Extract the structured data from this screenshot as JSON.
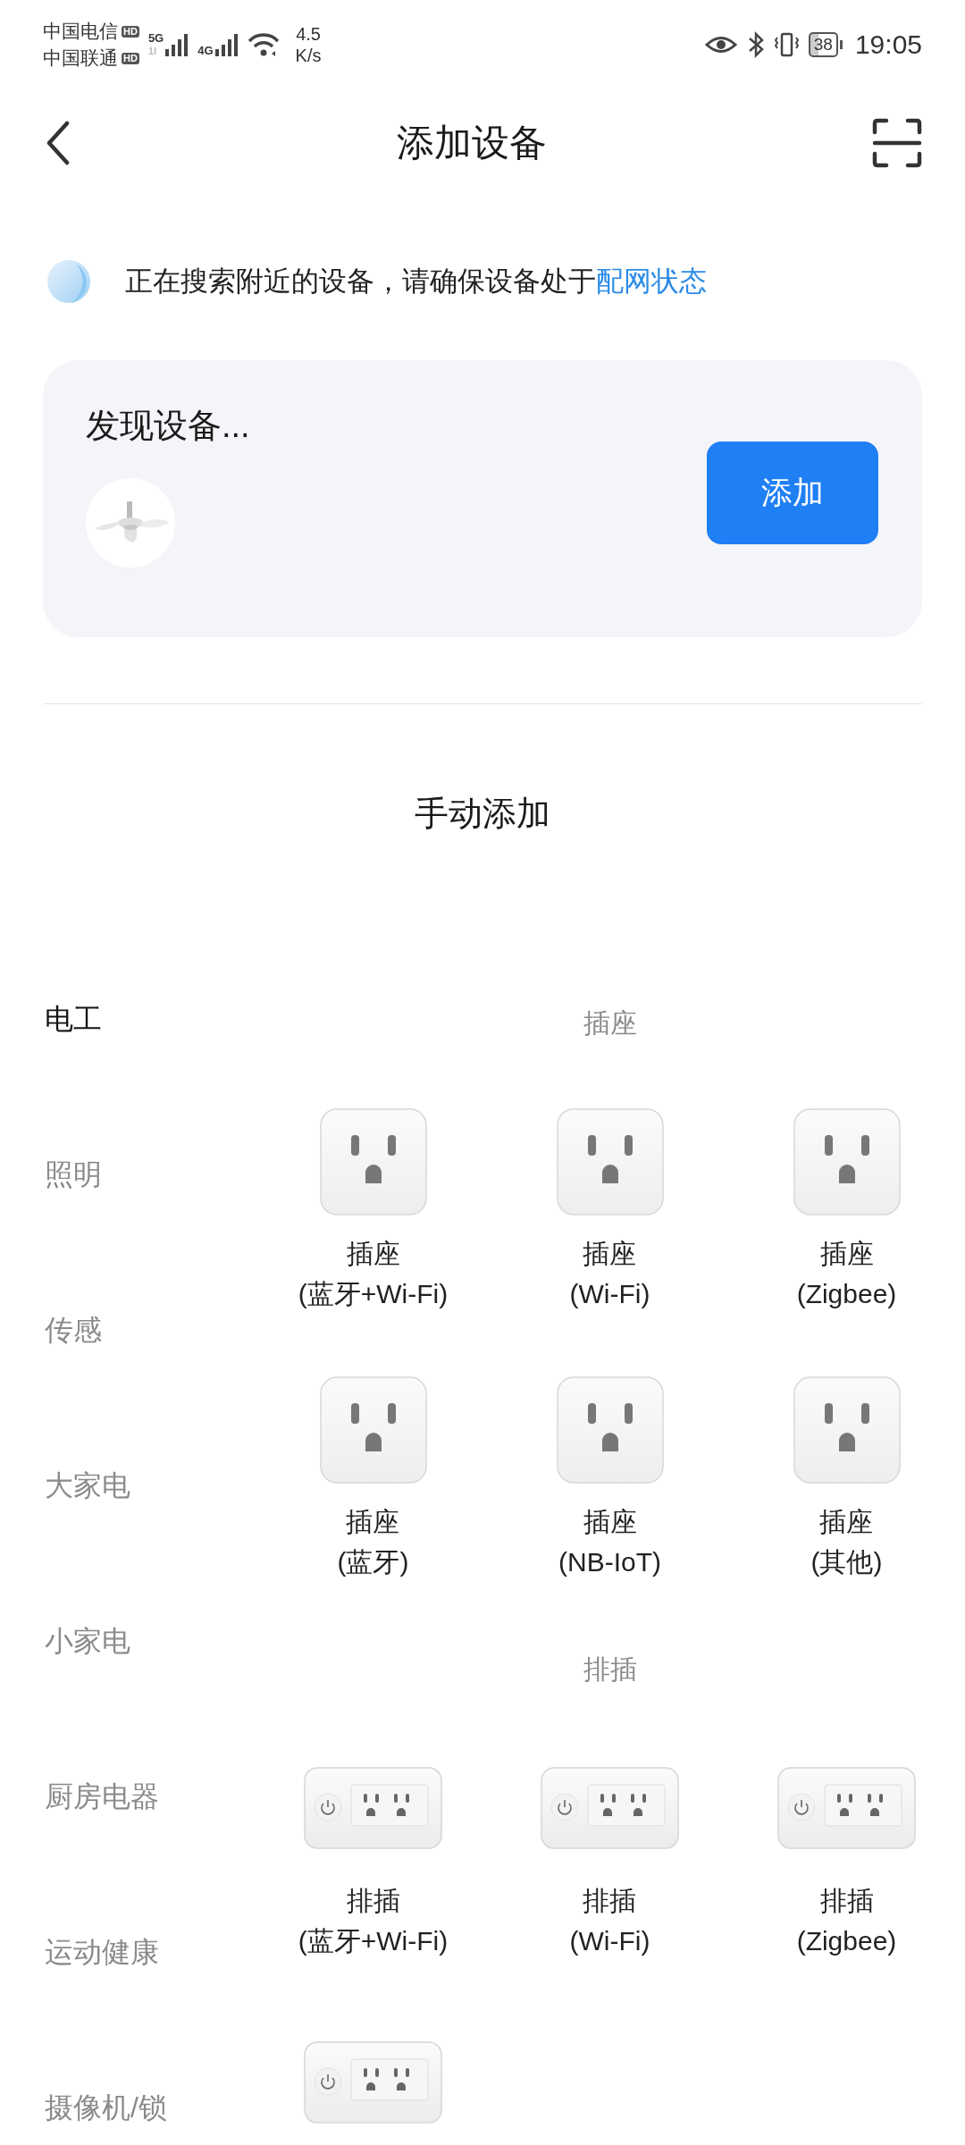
{
  "status_bar": {
    "carriers": [
      {
        "name": "中国电信",
        "badge": "HD"
      },
      {
        "name": "中国联通",
        "badge": "HD"
      }
    ],
    "networks": [
      {
        "label": "5G",
        "sub": "1l"
      },
      {
        "label": "4G"
      }
    ],
    "speed": {
      "value": "4.5",
      "unit": "K/s"
    },
    "battery": "38",
    "time": "19:05"
  },
  "header": {
    "title": "添加设备"
  },
  "notice": {
    "text": "正在搜索附近的设备，请确保设备处于",
    "link": "配网状态"
  },
  "discovered": {
    "title": "发现设备...",
    "button": "添加"
  },
  "manual_title": "手动添加",
  "categories": [
    {
      "label": "电工",
      "selected": true
    },
    {
      "label": "照明",
      "selected": false
    },
    {
      "label": "传感",
      "selected": false
    },
    {
      "label": "大家电",
      "selected": false
    },
    {
      "label": "小家电",
      "selected": false
    },
    {
      "label": "厨房电器",
      "selected": false
    },
    {
      "label": "运动健康",
      "selected": false
    },
    {
      "label": "摄像机/锁",
      "selected": false
    }
  ],
  "sections": [
    {
      "title": "插座",
      "items": [
        {
          "kind": "socket",
          "name": "插座",
          "variant": "(蓝牙+Wi-Fi)"
        },
        {
          "kind": "socket",
          "name": "插座",
          "variant": "(Wi-Fi)"
        },
        {
          "kind": "socket",
          "name": "插座",
          "variant": "(Zigbee)"
        },
        {
          "kind": "socket",
          "name": "插座",
          "variant": "(蓝牙)"
        },
        {
          "kind": "socket",
          "name": "插座",
          "variant": "(NB-IoT)"
        },
        {
          "kind": "socket",
          "name": "插座",
          "variant": "(其他)"
        }
      ]
    },
    {
      "title": "排插",
      "items": [
        {
          "kind": "strip",
          "name": "排插",
          "variant": "(蓝牙+Wi-Fi)"
        },
        {
          "kind": "strip",
          "name": "排插",
          "variant": "(Wi-Fi)"
        },
        {
          "kind": "strip",
          "name": "排插",
          "variant": "(Zigbee)"
        },
        {
          "kind": "strip"
        }
      ]
    }
  ]
}
